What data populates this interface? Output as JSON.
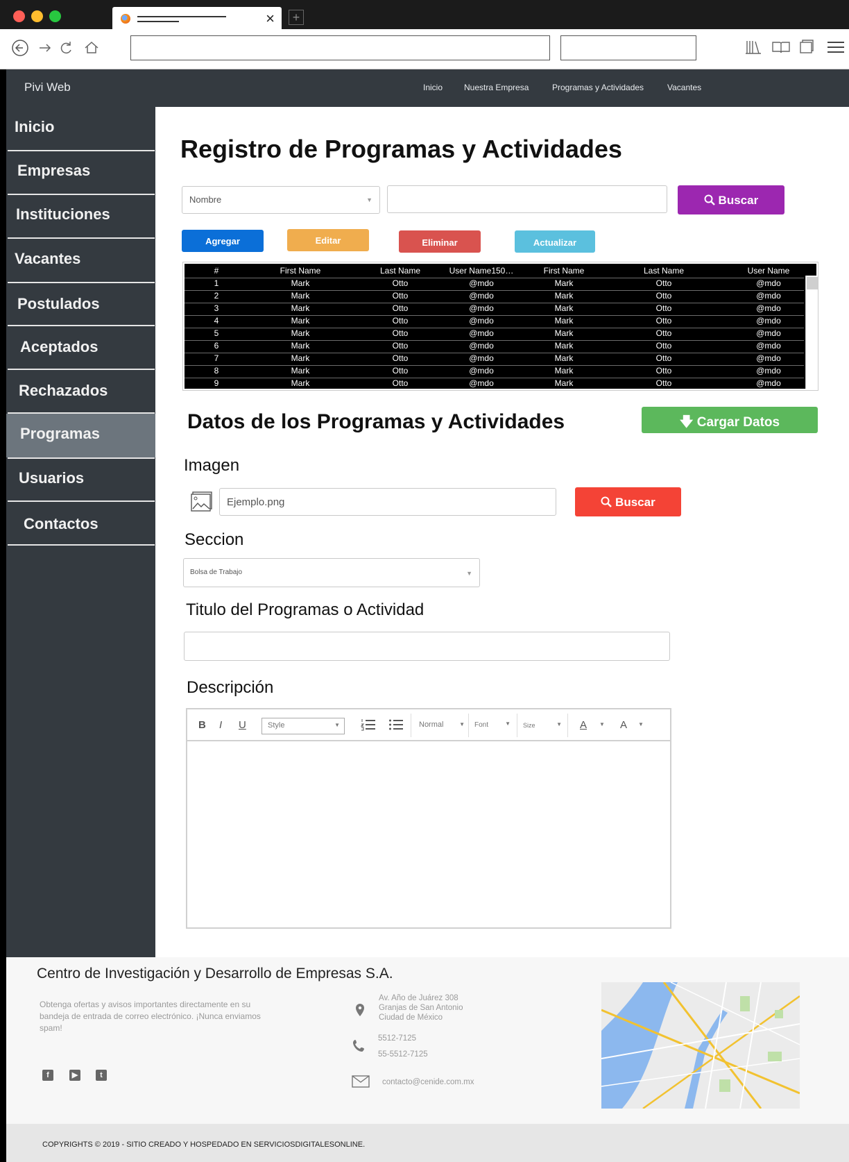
{
  "site": {
    "brand": "Pivi Web",
    "top_nav": [
      "Inicio",
      "Nuestra Empresa",
      "Programas y Actividades",
      "Vacantes"
    ]
  },
  "sidebar": {
    "items": [
      {
        "label": "Inicio"
      },
      {
        "label": "Empresas"
      },
      {
        "label": "Instituciones"
      },
      {
        "label": "Vacantes"
      },
      {
        "label": "Postulados"
      },
      {
        "label": "Aceptados"
      },
      {
        "label": "Rechazados"
      },
      {
        "label": "Programas",
        "active": true
      },
      {
        "label": "Usuarios"
      },
      {
        "label": "Contactos"
      }
    ]
  },
  "main": {
    "title": "Registro de Programas y Actividades",
    "search": {
      "filter_selected": "Nombre",
      "query": "",
      "search_button": "Buscar"
    },
    "actions": {
      "add": "Agregar",
      "edit": "Editar",
      "delete": "Eliminar",
      "refresh": "Actualizar"
    },
    "table": {
      "headers": [
        "#",
        "First Name",
        "Last Name",
        "User Name150…",
        "First Name",
        "Last Name",
        "User Name"
      ],
      "rows": [
        [
          "1",
          "Mark",
          "Otto",
          "@mdo",
          "Mark",
          "Otto",
          "@mdo"
        ],
        [
          "2",
          "Mark",
          "Otto",
          "@mdo",
          "Mark",
          "Otto",
          "@mdo"
        ],
        [
          "3",
          "Mark",
          "Otto",
          "@mdo",
          "Mark",
          "Otto",
          "@mdo"
        ],
        [
          "4",
          "Mark",
          "Otto",
          "@mdo",
          "Mark",
          "Otto",
          "@mdo"
        ],
        [
          "5",
          "Mark",
          "Otto",
          "@mdo",
          "Mark",
          "Otto",
          "@mdo"
        ],
        [
          "6",
          "Mark",
          "Otto",
          "@mdo",
          "Mark",
          "Otto",
          "@mdo"
        ],
        [
          "7",
          "Mark",
          "Otto",
          "@mdo",
          "Mark",
          "Otto",
          "@mdo"
        ],
        [
          "8",
          "Mark",
          "Otto",
          "@mdo",
          "Mark",
          "Otto",
          "@mdo"
        ],
        [
          "9",
          "Mark",
          "Otto",
          "@mdo",
          "Mark",
          "Otto",
          "@mdo"
        ]
      ]
    },
    "details": {
      "title": "Datos de los Programas y Actividades",
      "load_button": "Cargar Datos",
      "image_label": "Imagen",
      "image_value": "Ejemplo.png",
      "image_search_button": "Buscar",
      "section_label": "Seccion",
      "section_selected": "Bolsa de Trabajo",
      "title_label": "Titulo del Programas o Actividad",
      "title_value": "",
      "description_label": "Descripción",
      "editor": {
        "bold": "B",
        "italic": "I",
        "underline": "U",
        "style_select": "Style",
        "format_select": "Normal",
        "font_select": "Font",
        "size_select": "Size",
        "text_color": "A",
        "bg_color": "A"
      }
    }
  },
  "footer": {
    "company": "Centro de Investigación y Desarrollo de Empresas S.A.",
    "newsletter_text": "Obtenga ofertas y avisos importantes directamente en su bandeja de entrada de correo electrónico. ¡Nunca enviamos spam!",
    "address_lines": [
      "Av. Año de Juárez 308",
      "Granjas de San Antonio",
      "Ciudad de México"
    ],
    "phones": [
      "5512-7125",
      "55-5512-7125"
    ],
    "email": "contacto@cenide.com.mx",
    "social_icons": [
      "facebook-icon",
      "youtube-icon",
      "twitter-icon"
    ],
    "copyright": "COPYRIGHTS © 2019 - SITIO CREADO Y HOSPEDADO EN SERVICIOSDIGITALESONLINE."
  },
  "colors": {
    "header_bg": "#343a40",
    "sidebar_active": "#6c757d",
    "search_purple": "#9c27b0",
    "add_blue": "#0b6fd8",
    "edit_orange": "#f0ad4e",
    "delete_red": "#d9534f",
    "refresh_cyan": "#5bc0de",
    "load_green": "#5cb85c",
    "image_search_red": "#f44336"
  }
}
